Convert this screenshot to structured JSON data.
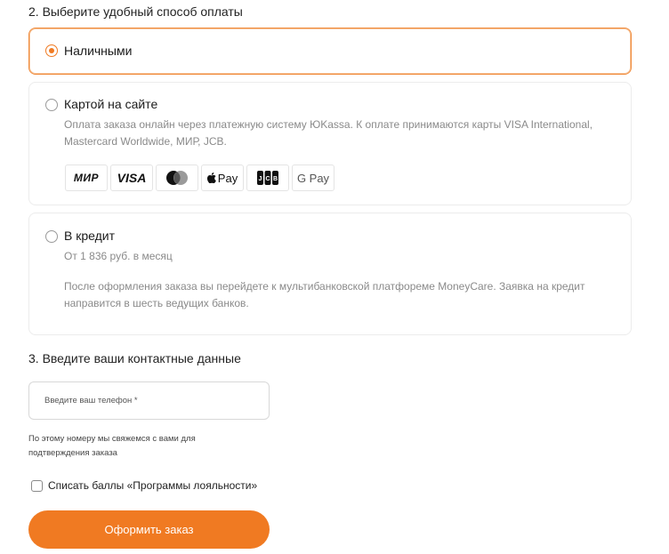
{
  "payment": {
    "title": "2. Выберите удобный способ оплаты",
    "options": [
      {
        "label": "Наличными",
        "selected": true
      },
      {
        "label": "Картой на сайте",
        "selected": false,
        "description_line1": "Оплата заказа онлайн через платежную систему ЮKassa. К оплате принимаются карты VISA International,",
        "description_line2": "Mastercard Worldwide, МИР, JCB.",
        "methods": [
          "МИР",
          "VISA",
          "Mastercard",
          "Apple Pay",
          "JCB",
          "G Pay"
        ]
      },
      {
        "label": "В кредит",
        "selected": false,
        "price_note": "От 1 836 руб. в месяц",
        "description_line1": "После оформления заказа вы перейдете к мультибанковской платфореме MoneyCare. Заявка на кредит",
        "description_line2": "направится в шесть ведущих банков."
      }
    ]
  },
  "contacts": {
    "title": "3. Введите ваши контактные данные",
    "phone_placeholder": "Введите ваш телефон *",
    "helper_line1": "По этому номеру мы свяжемся с вами для",
    "helper_line2": "подтверждения заказа",
    "loyalty_label": "Списать баллы «Программы лояльности»",
    "loyalty_checked": false
  },
  "submit_label": "Оформить заказ",
  "colors": {
    "accent": "#f07a22",
    "selected_border": "#f08a3a"
  },
  "icons": {
    "mastercard": "mastercard-logo-icon",
    "apple_pay": "apple-icon",
    "jcb": "jcb-logo-icon"
  }
}
